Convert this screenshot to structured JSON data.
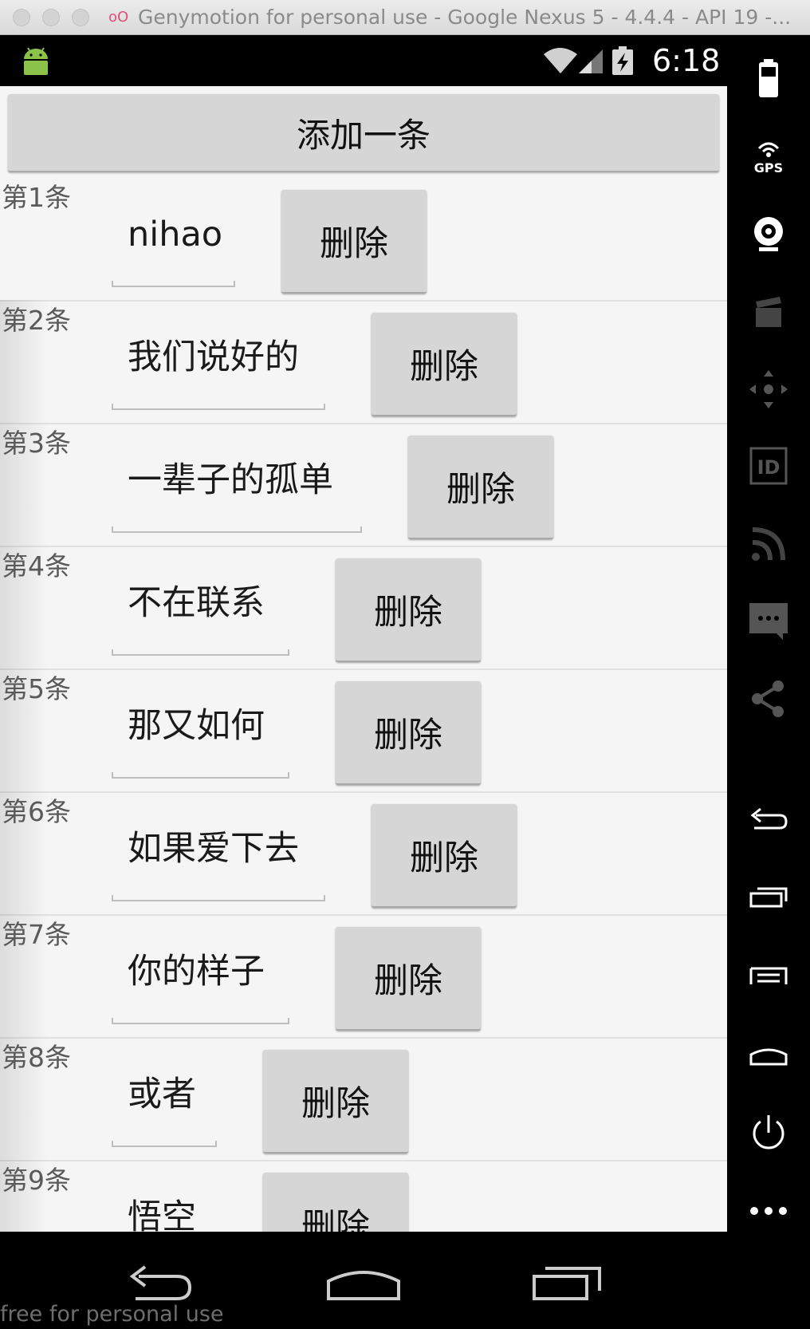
{
  "window": {
    "title": "Genymotion for personal use - Google Nexus 5 - 4.4.4 - API 19 -..."
  },
  "statusbar": {
    "time": "6:18"
  },
  "app": {
    "add_button_label": "添加一条",
    "delete_label": "删除",
    "rows": [
      {
        "label": "第1条",
        "text": "nihao"
      },
      {
        "label": "第2条",
        "text": "我们说好的"
      },
      {
        "label": "第3条",
        "text": "一辈子的孤单"
      },
      {
        "label": "第4条",
        "text": "不在联系"
      },
      {
        "label": "第5条",
        "text": "那又如何"
      },
      {
        "label": "第6条",
        "text": "如果爱下去"
      },
      {
        "label": "第7条",
        "text": "你的样子"
      },
      {
        "label": "第8条",
        "text": "或者"
      },
      {
        "label": "第9条",
        "text": "悟空"
      }
    ]
  },
  "toolbar": {
    "gps_label": "GPS",
    "id_label": "ID",
    "items": [
      "battery-icon",
      "gps-icon",
      "webcam-icon",
      "capture-icon",
      "dpad-icon",
      "id-icon",
      "rss-icon",
      "sms-icon",
      "share-icon",
      "back-icon",
      "recent-apps-icon",
      "menu-icon",
      "home-icon",
      "power-icon",
      "more-icon"
    ]
  },
  "navbar": {
    "items": [
      "back-icon",
      "home-icon",
      "recent-apps-icon"
    ]
  },
  "watermark": "free for personal use",
  "colors": {
    "app_background": "#f5f5f5",
    "button_background": "#d6d6d6",
    "chrome_background": "#000000"
  }
}
